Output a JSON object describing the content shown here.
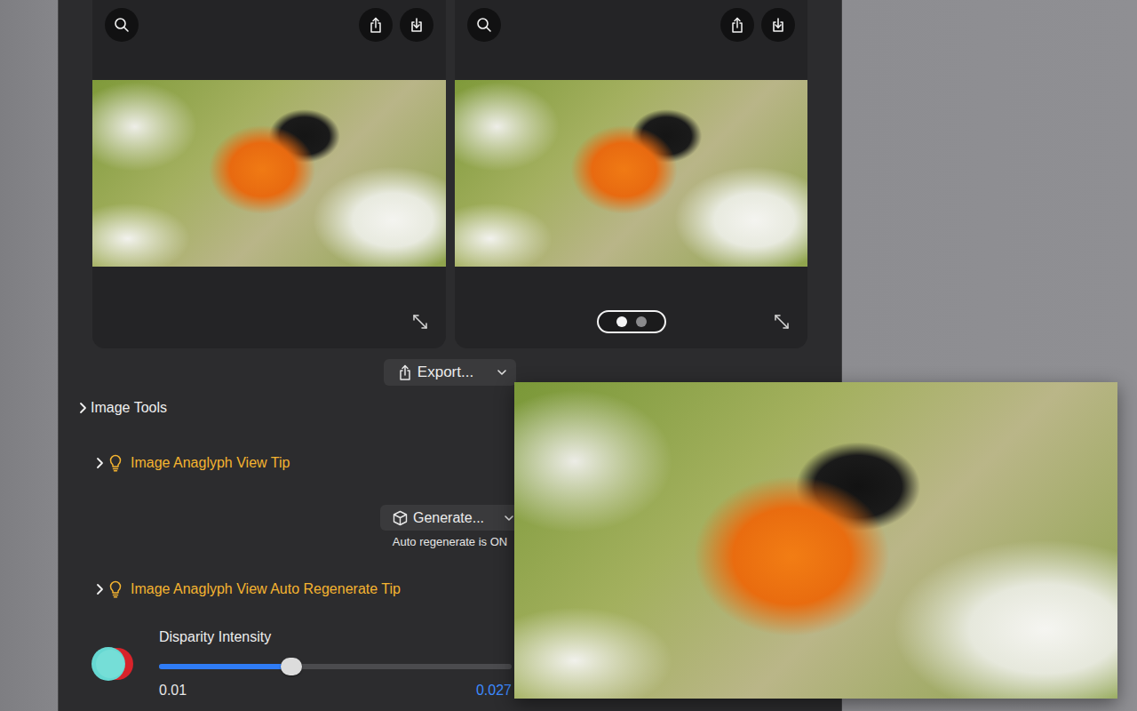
{
  "panels": [
    {
      "kind": "plain"
    },
    {
      "kind": "paged",
      "pager": [
        {
          "selected": true
        },
        {
          "selected": false
        }
      ]
    }
  ],
  "export_button": {
    "label": "Export..."
  },
  "rows": [
    {
      "kind": "section",
      "label": "Image Tools",
      "expanded": false
    },
    {
      "kind": "tip",
      "label": "Image Anaglyph View Tip",
      "expanded": false
    },
    {
      "kind": "action",
      "label": "Generate...",
      "note": "Auto regenerate is ON"
    },
    {
      "kind": "tip",
      "label": "Image Anaglyph View Auto Regenerate Tip",
      "expanded": false
    },
    {
      "kind": "slider",
      "label": "Disparity Intensity",
      "min": "0.01",
      "value": "0.027",
      "level": 0.375
    }
  ]
}
